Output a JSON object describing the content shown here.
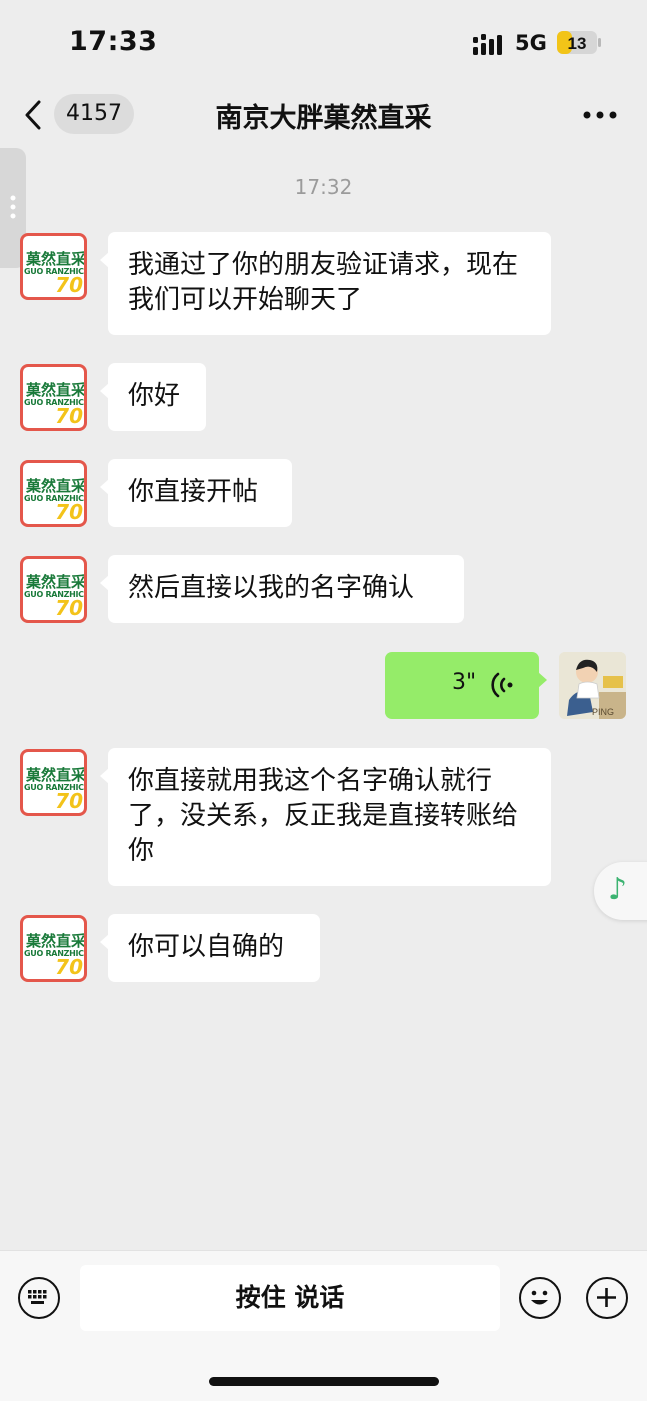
{
  "status_bar": {
    "time": "17:33",
    "network": "5G",
    "battery": "13"
  },
  "nav": {
    "back_count": "4157",
    "title": "南京大胖菓然直采"
  },
  "chat": {
    "timestamp": "17:32",
    "avatar": {
      "line1": "菓然直采",
      "line2": "GUO RANZHICAI",
      "badge": "70"
    },
    "messages": [
      {
        "text": "我通过了你的朋友验证请求，现在我们可以开始聊天了"
      },
      {
        "text": "你好"
      },
      {
        "text": "你直接开帖"
      },
      {
        "text": "然后直接以我的名字确认"
      },
      {
        "text": "你直接就用我这个名字确认就行了，没关系，反正我是直接转账给你"
      },
      {
        "text": "你可以自确的"
      }
    ],
    "voice_message": {
      "duration": "3\""
    },
    "my_avatar_label": "PING"
  },
  "bottom": {
    "hold_to_talk": "按住 说话"
  },
  "colors": {
    "bg": "#ededed",
    "my_bubble": "#95ec69",
    "avatar_border": "#e4574b"
  },
  "icons": [
    "back-chevron-icon",
    "more-icon",
    "voice-wave-icon",
    "music-note-icon",
    "keyboard-icon",
    "emoji-icon",
    "plus-icon"
  ]
}
